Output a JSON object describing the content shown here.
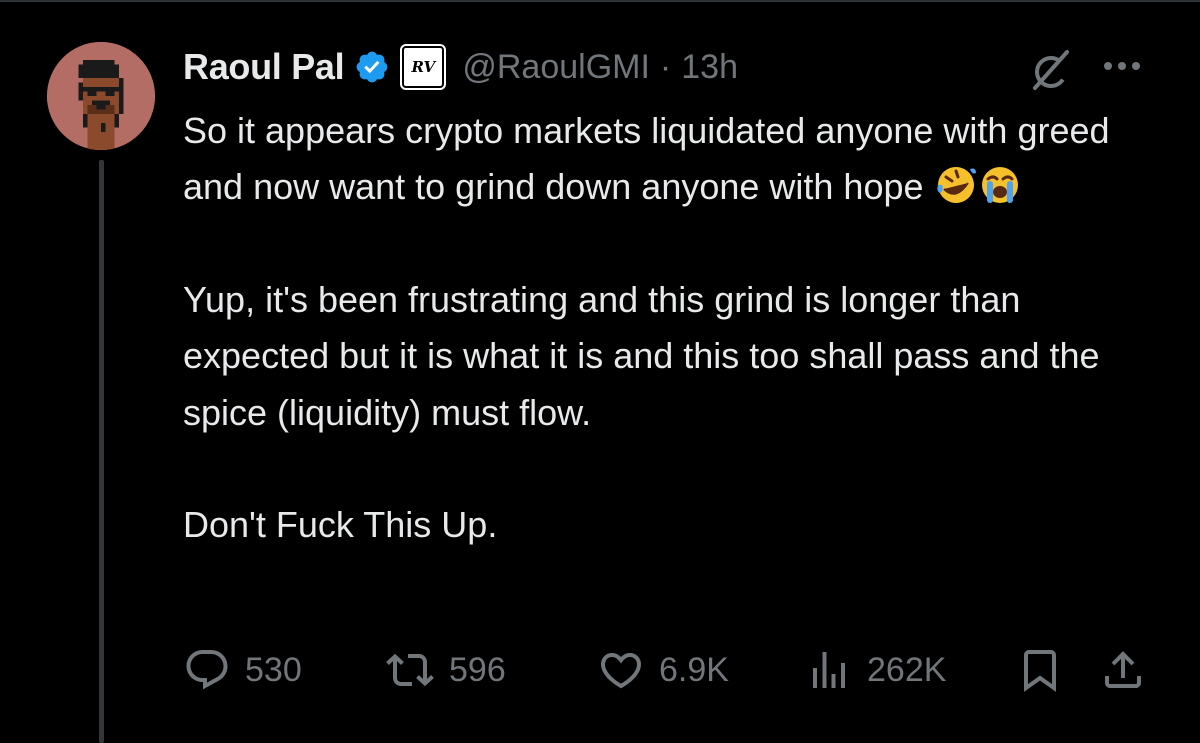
{
  "tweet": {
    "author_name": "Raoul Pal",
    "affiliate_badge": "RV",
    "handle": "@RaoulGMI",
    "separator": "·",
    "time": "13h",
    "paragraphs": [
      "So it appears crypto markets liquidated anyone with greed and now want to grind down anyone with hope",
      "Yup, it's been frustrating and this grind is longer than expected but it is what it is and this too shall pass and the spice (liquidity) must flow.",
      "Don't Fuck This Up."
    ],
    "emojis": [
      "rolling-on-floor-laughing-emoji",
      "loudly-crying-emoji"
    ]
  },
  "metrics": {
    "replies": "530",
    "reposts": "596",
    "likes": "6.9K",
    "views": "262K"
  },
  "icons": [
    "verified-icon",
    "grok-icon",
    "more-icon",
    "reply-icon",
    "repost-icon",
    "like-icon",
    "views-icon",
    "bookmark-icon",
    "share-icon"
  ],
  "colors": {
    "background": "#000000",
    "text": "#e7e9ea",
    "secondary": "#71767b",
    "verified": "#1d9bf0",
    "avatar_bg": "#b36d65"
  }
}
